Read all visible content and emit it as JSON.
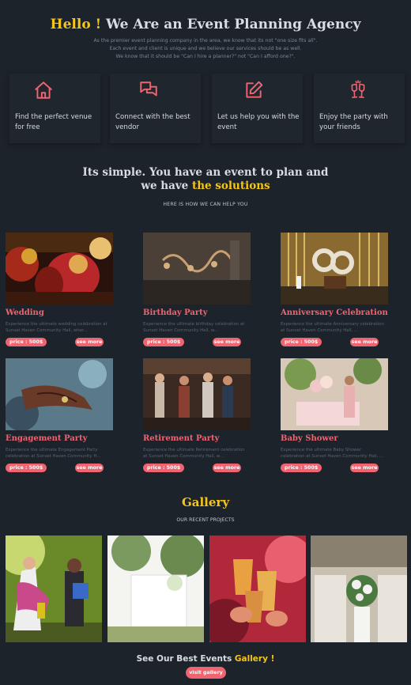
{
  "hero": {
    "title_accent": "Hello !",
    "title_rest": " We Are an Event Planning Agency",
    "desc_lines": [
      "As the premier event planning company in the area, we know that its not \"one size fits all\".",
      "Each event and client is unique and we believe our services should be as well.",
      "We know that it should be \"Can I hire a planner?\" not \"Can I afford one?\"."
    ]
  },
  "features": [
    {
      "icon": "home-icon",
      "label": "Find the perfect venue for free"
    },
    {
      "icon": "chat-icon",
      "label": "Connect with the best vendor"
    },
    {
      "icon": "edit-icon",
      "label": "Let us help you with the event"
    },
    {
      "icon": "champagne-icon",
      "label": "Enjoy the party with your friends"
    }
  ],
  "solutions": {
    "line1": "Its simple. You have an event to plan and",
    "line2_prefix": "we have ",
    "line2_accent": "the solutions",
    "subtitle": "HERE IS HOW WE CAN HELP YOU"
  },
  "events": [
    {
      "title": "Wedding",
      "desc": "Experience the ultimate wedding celebration at Sunset Haven Community Hall, wher...",
      "price": "price : 500$",
      "more": "see more"
    },
    {
      "title": "Birthday Party",
      "desc": "Experience the ultimate birthday celebration at Sunset Haven Community Hall, w...",
      "price": "price : 500$",
      "more": "see more"
    },
    {
      "title": "Anniversary Celebration",
      "desc": "Experience the ultimate Anniversary celebration at Sunset Haven Community Hall, ...",
      "price": "price : 500$",
      "more": "see more"
    },
    {
      "title": "Engagement Party",
      "desc": "Experience the ultimate Engagement Party celebration at Sunset Haven Community H...",
      "price": "price : 500$",
      "more": "see more"
    },
    {
      "title": "Retirement Party",
      "desc": "Experience the ultimate Retirement celebration at Sunset Haven Community Hall, w...",
      "price": "price : 500$",
      "more": "see more"
    },
    {
      "title": "Baby Shower",
      "desc": "Experience the ultimate Baby Shower celebration at Sunset Haven Community Hall, ...",
      "price": "price : 500$",
      "more": "see more"
    }
  ],
  "gallery": {
    "title": "Gallery",
    "subtitle": "OUR RECENT PROJECTS",
    "best_prefix": "See Our Best Events ",
    "best_accent": "Gallery !",
    "visit": "visit gallery"
  },
  "colors": {
    "background": "#1d232b",
    "accent_yellow": "#f5c518",
    "accent_pink": "#ef6470"
  }
}
